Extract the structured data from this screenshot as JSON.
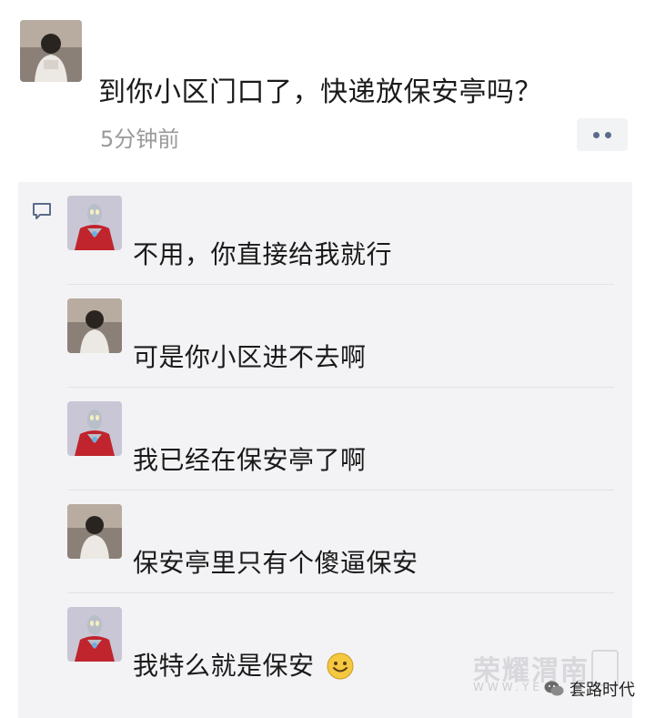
{
  "post": {
    "text": "到你小区门口了，快递放保安亭吗？",
    "time": "5分钟前"
  },
  "comments": [
    {
      "author": "ultraman",
      "text": "不用，你直接给我就行"
    },
    {
      "author": "courier",
      "text": "可是你小区进不去啊"
    },
    {
      "author": "ultraman",
      "text": "我已经在保安亭了啊"
    },
    {
      "author": "courier",
      "text": "保安亭里只有个傻逼保安"
    },
    {
      "author": "ultraman",
      "text": "我特么就是保安"
    }
  ],
  "watermark": {
    "brand": "荣耀渭南",
    "url": "WWW.YE"
  },
  "account": {
    "name": "套路时代"
  },
  "colors": {
    "comment_bg": "#f3f3f5",
    "time_text": "#9a9a9a",
    "link_blue": "#5b6b8a"
  }
}
